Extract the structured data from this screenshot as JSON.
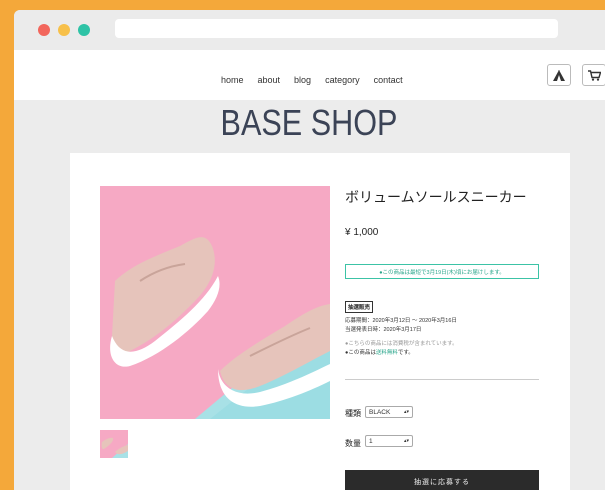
{
  "nav": {
    "links": [
      "home",
      "about",
      "blog",
      "category",
      "contact"
    ]
  },
  "header": {
    "title": "BASE SHOP"
  },
  "icons": {
    "tent": "tent-icon",
    "cart": "cart-icon"
  },
  "product": {
    "name": "ボリュームソールスニーカー",
    "price": "¥ 1,000",
    "delivery_notice": "●この商品は最短で3月19日(木)頃にお届けします。",
    "lottery_badge": "抽選販売",
    "entry_period": "応募期間：2020年3月12日 〜 2020年3月16日",
    "result_date": "当選発表日時：2020年3月17日",
    "note_contains": "●こちらの商品には消費税が含まれています。",
    "shipping_prefix": "●この商品は",
    "shipping_accent": "送料無料",
    "shipping_suffix": "です。",
    "variant_label": "種類",
    "variant_value": "BLACK",
    "quantity_label": "数量",
    "quantity_value": "1",
    "apply_button": "抽選に応募する"
  },
  "colors": {
    "accent": "#3cc3a6",
    "background": "#f4a83a",
    "title": "#3b4356"
  }
}
